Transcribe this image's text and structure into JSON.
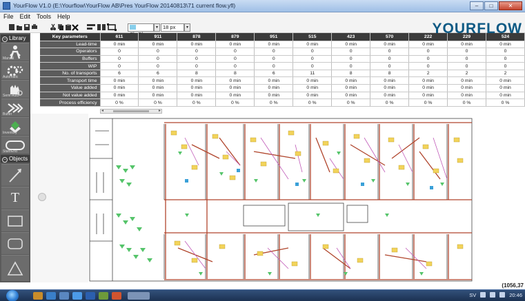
{
  "window": {
    "title": "YourFlow V1.0 (E:\\Yourflow\\YourFlow AB\\Pres YourFlow 20140813\\71 current flow.yfl)",
    "buttons": [
      "–",
      "□",
      "✕"
    ]
  },
  "menu": [
    "File",
    "Edit",
    "Tools",
    "Help"
  ],
  "toolbar": {
    "color_value": "SkyBlue",
    "font_size_value": "18 px",
    "dropdown_glyph": "▾",
    "icons": [
      "new-icon",
      "open-icon",
      "save-icon",
      "print-icon",
      "cut-icon",
      "copy-icon",
      "paste-icon",
      "delete-icon",
      "align-icon",
      "group-icon",
      "fit-icon"
    ]
  },
  "brand": "YOURFLOW",
  "palette": {
    "library_label": "Library",
    "objects_label": "Objects",
    "library_items": [
      {
        "icon": "manual-worker-icon",
        "caption": "Manual"
      },
      {
        "icon": "automatic-gears-icon",
        "caption": "Automatic"
      },
      {
        "icon": "semi-automatic-icon",
        "caption": "Semi-Auto"
      },
      {
        "icon": "buffer-arrows-icon",
        "caption": "Buffer"
      },
      {
        "icon": "inventory-icon",
        "caption": "Inventory"
      },
      {
        "icon": "start-end-icon",
        "caption": "Start/End"
      }
    ],
    "object_items": [
      {
        "icon": "line-tool-icon",
        "glyph": ""
      },
      {
        "icon": "text-tool-icon",
        "glyph": "T"
      },
      {
        "icon": "rectangle-tool-icon",
        "glyph": ""
      },
      {
        "icon": "rounded-rectangle-tool-icon",
        "glyph": ""
      },
      {
        "icon": "triangle-tool-icon",
        "glyph": ""
      }
    ]
  },
  "key_parameters": {
    "header": "Key parameters",
    "columns": [
      "611",
      "911",
      "878",
      "879",
      "951",
      "515",
      "423",
      "570",
      "222",
      "229",
      "524"
    ],
    "rows": [
      {
        "label": "Lead-time",
        "values": [
          "0 min",
          "0 min",
          "0 min",
          "0 min",
          "0 min",
          "0 min",
          "0 min",
          "0 min",
          "0 min",
          "0 min",
          "0 min"
        ]
      },
      {
        "label": "Operators",
        "values": [
          "0",
          "0",
          "0",
          "0",
          "0",
          "0",
          "0",
          "0",
          "0",
          "0",
          "0"
        ]
      },
      {
        "label": "Buffers",
        "values": [
          "0",
          "0",
          "0",
          "0",
          "0",
          "0",
          "0",
          "0",
          "0",
          "0",
          "0"
        ]
      },
      {
        "label": "WIP",
        "values": [
          "0",
          "0",
          "0",
          "0",
          "0",
          "0",
          "0",
          "0",
          "0",
          "0",
          "0"
        ]
      },
      {
        "label": "No. of transports",
        "values": [
          "6",
          "6",
          "8",
          "8",
          "6",
          "11",
          "8",
          "8",
          "2",
          "2",
          "2"
        ]
      },
      {
        "label": "Transport time",
        "values": [
          "0 min",
          "0 min",
          "0 min",
          "0 min",
          "0 min",
          "0 min",
          "0 min",
          "0 min",
          "0 min",
          "0 min",
          "0 min"
        ]
      },
      {
        "label": "Value added",
        "values": [
          "0 min",
          "0 min",
          "0 min",
          "0 min",
          "0 min",
          "0 min",
          "0 min",
          "0 min",
          "0 min",
          "0 min",
          "0 min"
        ]
      },
      {
        "label": "Not value added",
        "values": [
          "0 min",
          "0 min",
          "0 min",
          "0 min",
          "0 min",
          "0 min",
          "0 min",
          "0 min",
          "0 min",
          "0 min",
          "0 min"
        ]
      },
      {
        "label": "Process efficiency",
        "values": [
          "0 %",
          "0 %",
          "0 %",
          "0 %",
          "0 %",
          "0 %",
          "0 %",
          "0 %",
          "0 %",
          "0 %",
          "0 %"
        ]
      }
    ]
  },
  "scrollbar": {
    "left": "◂",
    "right": "▸",
    "grip": "III"
  },
  "status": {
    "coordinates": "(1056,37"
  },
  "taskbar": {
    "apps": [
      "explorer-icon",
      "media-icon",
      "files-icon",
      "ie-icon",
      "word-icon",
      "yourflow-icon",
      "powerpoint-icon",
      "yourflow-window-icon"
    ],
    "lang": "SV",
    "time": "20:46"
  },
  "colors": {
    "accent": "#0e5a84",
    "header_dark": "#3b3b3b",
    "palette": "#5b5b5b",
    "flow_line": "#b0452c",
    "machine": "#f2d35a",
    "operator": "#55c46a"
  }
}
